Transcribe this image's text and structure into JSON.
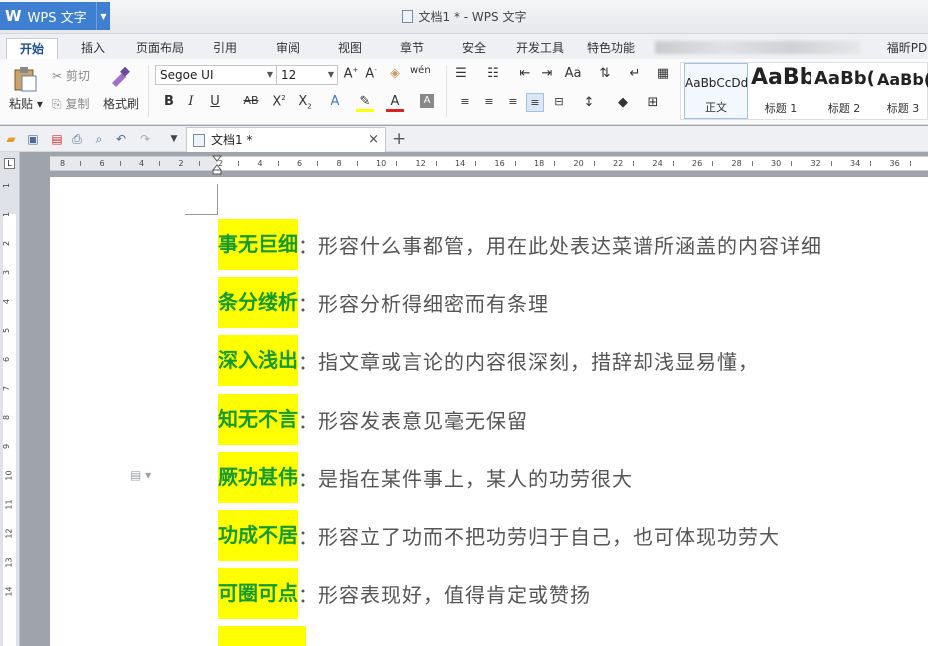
{
  "app": {
    "name": "WPS 文字",
    "title": "文档1 * - WPS 文字"
  },
  "ribbon_tabs": [
    "开始",
    "插入",
    "页面布局",
    "引用",
    "审阅",
    "视图",
    "章节",
    "安全",
    "开发工具",
    "特色功能",
    "福昕PD"
  ],
  "clipboard": {
    "paste": "粘贴",
    "cut": "剪切",
    "copy": "复制",
    "format_painter": "格式刷"
  },
  "font": {
    "name": "Segoe UI",
    "size": "12"
  },
  "styles": [
    {
      "preview": "AaBbCcDd",
      "name": "正文"
    },
    {
      "preview": "AaBb",
      "name": "标题 1"
    },
    {
      "preview": "AaBb(",
      "name": "标题 2"
    },
    {
      "preview": "AaBb(",
      "name": "标题 3"
    }
  ],
  "doc_tab": {
    "label": "文档1 *"
  },
  "ruler_h": [
    "8",
    "6",
    "4",
    "2",
    "2",
    "4",
    "6",
    "8",
    "10",
    "12",
    "14",
    "16",
    "18",
    "20",
    "22",
    "24",
    "26",
    "28",
    "30",
    "32",
    "34",
    "36"
  ],
  "ruler_v": [
    "1",
    "1",
    "2",
    "3",
    "4",
    "5",
    "6",
    "7",
    "8",
    "9",
    "10",
    "11",
    "12",
    "13",
    "14"
  ],
  "entries": [
    {
      "term": "事无巨细",
      "desc": "形容什么事都管，用在此处表达菜谱所涵盖的内容详细"
    },
    {
      "term": "条分缕析",
      "desc": "形容分析得细密而有条理"
    },
    {
      "term": "深入浅出",
      "desc": "指文章或言论的内容很深刻，措辞却浅显易懂，"
    },
    {
      "term": "知无不言",
      "desc": "形容发表意见毫无保留"
    },
    {
      "term": "厥功甚伟",
      "desc": "是指在某件事上，某人的功劳很大"
    },
    {
      "term": "功成不居",
      "desc": "形容立了功而不把功劳归于自己，也可体现功劳大"
    },
    {
      "term": "可圈可点",
      "desc": "形容表现好，值得肯定或赞扬"
    },
    {
      "term": "",
      "desc": ""
    }
  ],
  "colors": {
    "highlight": "#ffff00",
    "term_text": "#159a2e",
    "accent": "#3f7fd1"
  }
}
